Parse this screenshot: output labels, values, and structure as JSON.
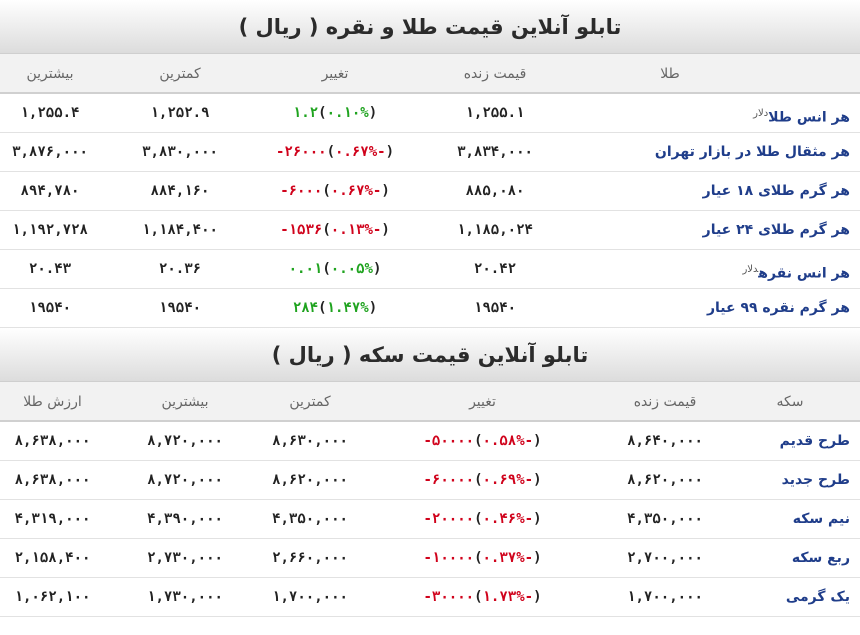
{
  "gold": {
    "title": "تابلو آنلاین قیمت طلا و نقره ( ریال )",
    "headers": {
      "name": "طلا",
      "price": "قیمت زنده",
      "change": "تغییر",
      "low": "کمترین",
      "high": "بیشترین"
    },
    "rows": [
      {
        "name": "هر انس طلا",
        "unit": "دلار",
        "price": "۱,۲۵۵.۱",
        "chg_val": "۱.۲",
        "chg_pct": "۰.۱۰%",
        "dir": "up",
        "low": "۱,۲۵۲.۹",
        "high": "۱,۲۵۵.۴"
      },
      {
        "name": "هر مثقال طلا در بازار تهران",
        "unit": "",
        "price": "۳,۸۳۴,۰۰۰",
        "chg_val": "-۲۶۰۰۰",
        "chg_pct": "۰.۶۷%-",
        "dir": "down",
        "low": "۳,۸۳۰,۰۰۰",
        "high": "۳,۸۷۶,۰۰۰"
      },
      {
        "name": "هر گرم طلای ۱۸ عیار",
        "unit": "",
        "price": "۸۸۵,۰۸۰",
        "chg_val": "-۶۰۰۰",
        "chg_pct": "۰.۶۷%-",
        "dir": "down",
        "low": "۸۸۴,۱۶۰",
        "high": "۸۹۴,۷۸۰"
      },
      {
        "name": "هر گرم طلای ۲۴ عیار",
        "unit": "",
        "price": "۱,۱۸۵,۰۲۴",
        "chg_val": "-۱۵۳۶",
        "chg_pct": "۰.۱۳%-",
        "dir": "down",
        "low": "۱,۱۸۴,۴۰۰",
        "high": "۱,۱۹۲,۷۲۸"
      },
      {
        "name": "هر انس نقره",
        "unit": "دلار",
        "price": "۲۰.۴۲",
        "chg_val": "۰.۰۱",
        "chg_pct": "۰.۰۵%",
        "dir": "up",
        "low": "۲۰.۳۶",
        "high": "۲۰.۴۳"
      },
      {
        "name": "هر گرم نقره ۹۹ عیار",
        "unit": "",
        "price": "۱۹۵۴۰",
        "chg_val": "۲۸۴",
        "chg_pct": "۱.۴۷%",
        "dir": "up",
        "low": "۱۹۵۴۰",
        "high": "۱۹۵۴۰"
      }
    ]
  },
  "coin": {
    "title": "تابلو آنلاین قیمت سکه ( ریال )",
    "headers": {
      "name": "سکه",
      "price": "قیمت زنده",
      "change": "تغییر",
      "low": "کمترین",
      "high": "بیشترین",
      "value": "ارزش طلا"
    },
    "rows": [
      {
        "name": "طرح قدیم",
        "price": "۸,۶۴۰,۰۰۰",
        "chg_val": "-۵۰۰۰۰",
        "chg_pct": "۰.۵۸%-",
        "dir": "down",
        "low": "۸,۶۳۰,۰۰۰",
        "high": "۸,۷۲۰,۰۰۰",
        "value": "۸,۶۳۸,۰۰۰"
      },
      {
        "name": "طرح جدید",
        "price": "۸,۶۲۰,۰۰۰",
        "chg_val": "-۶۰۰۰۰",
        "chg_pct": "۰.۶۹%-",
        "dir": "down",
        "low": "۸,۶۲۰,۰۰۰",
        "high": "۸,۷۲۰,۰۰۰",
        "value": "۸,۶۳۸,۰۰۰"
      },
      {
        "name": "نیم سکه",
        "price": "۴,۳۵۰,۰۰۰",
        "chg_val": "-۲۰۰۰۰",
        "chg_pct": "۰.۴۶%-",
        "dir": "down",
        "low": "۴,۳۵۰,۰۰۰",
        "high": "۴,۳۹۰,۰۰۰",
        "value": "۴,۳۱۹,۰۰۰"
      },
      {
        "name": "ربع سکه",
        "price": "۲,۷۰۰,۰۰۰",
        "chg_val": "-۱۰۰۰۰",
        "chg_pct": "۰.۳۷%-",
        "dir": "down",
        "low": "۲,۶۶۰,۰۰۰",
        "high": "۲,۷۳۰,۰۰۰",
        "value": "۲,۱۵۸,۴۰۰"
      },
      {
        "name": "یک گرمی",
        "price": "۱,۷۰۰,۰۰۰",
        "chg_val": "-۳۰۰۰۰",
        "chg_pct": "۱.۷۳%-",
        "dir": "down",
        "low": "۱,۷۰۰,۰۰۰",
        "high": "۱,۷۳۰,۰۰۰",
        "value": "۱,۰۶۲,۱۰۰"
      }
    ]
  },
  "colors": {
    "up": "#1fa31f",
    "down": "#d0021b",
    "name": "#1f3d8a"
  }
}
